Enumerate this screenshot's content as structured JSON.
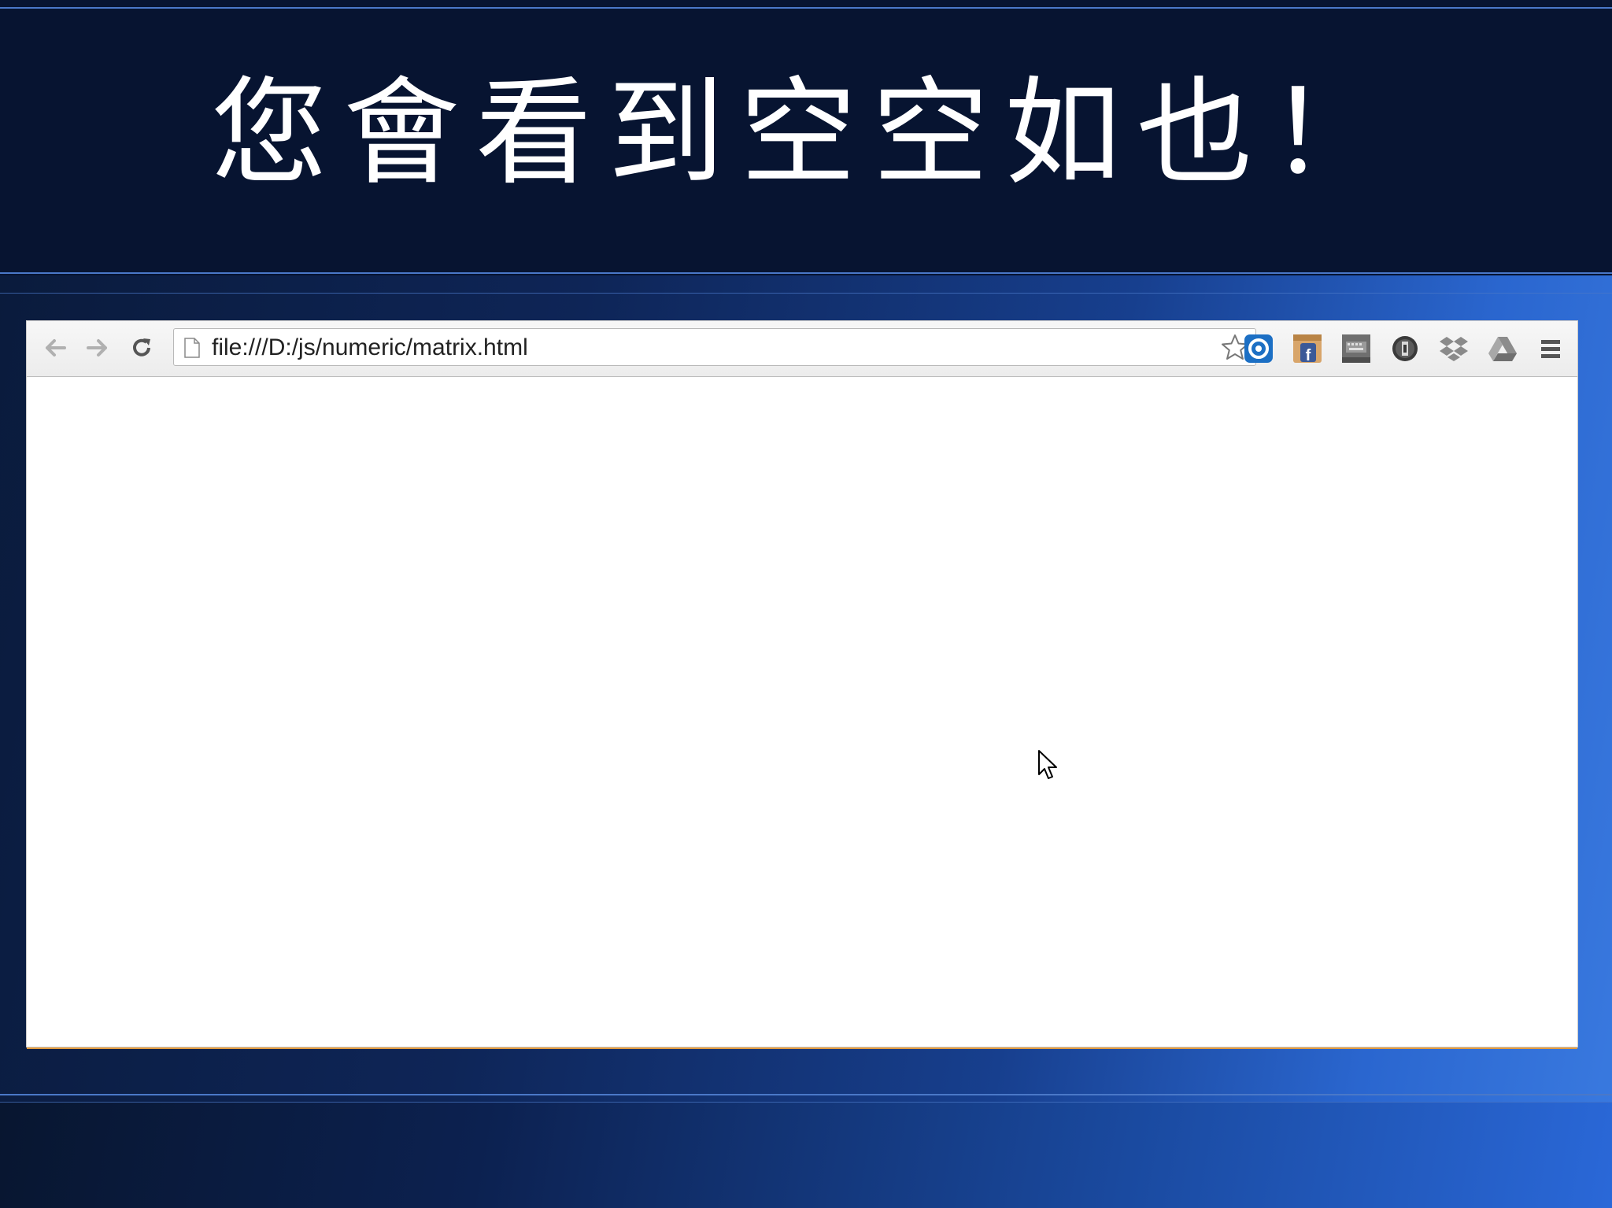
{
  "slide": {
    "title": "您會看到空空如也！"
  },
  "browser": {
    "address_bar": {
      "url": "file:///D:/js/numeric/matrix.html"
    },
    "icons": {
      "back": "back-arrow-icon",
      "forward": "forward-arrow-icon",
      "reload": "reload-icon",
      "page": "page-icon",
      "bookmark": "star-icon",
      "extensions": [
        "extension-blue-icon",
        "facebook-icon",
        "keyboard-icon",
        "extension-dark-icon",
        "dropbox-icon",
        "drive-icon"
      ],
      "menu": "menu-icon"
    },
    "colors": {
      "frame_border": "#e29a3e",
      "title_band": "#071431"
    }
  }
}
